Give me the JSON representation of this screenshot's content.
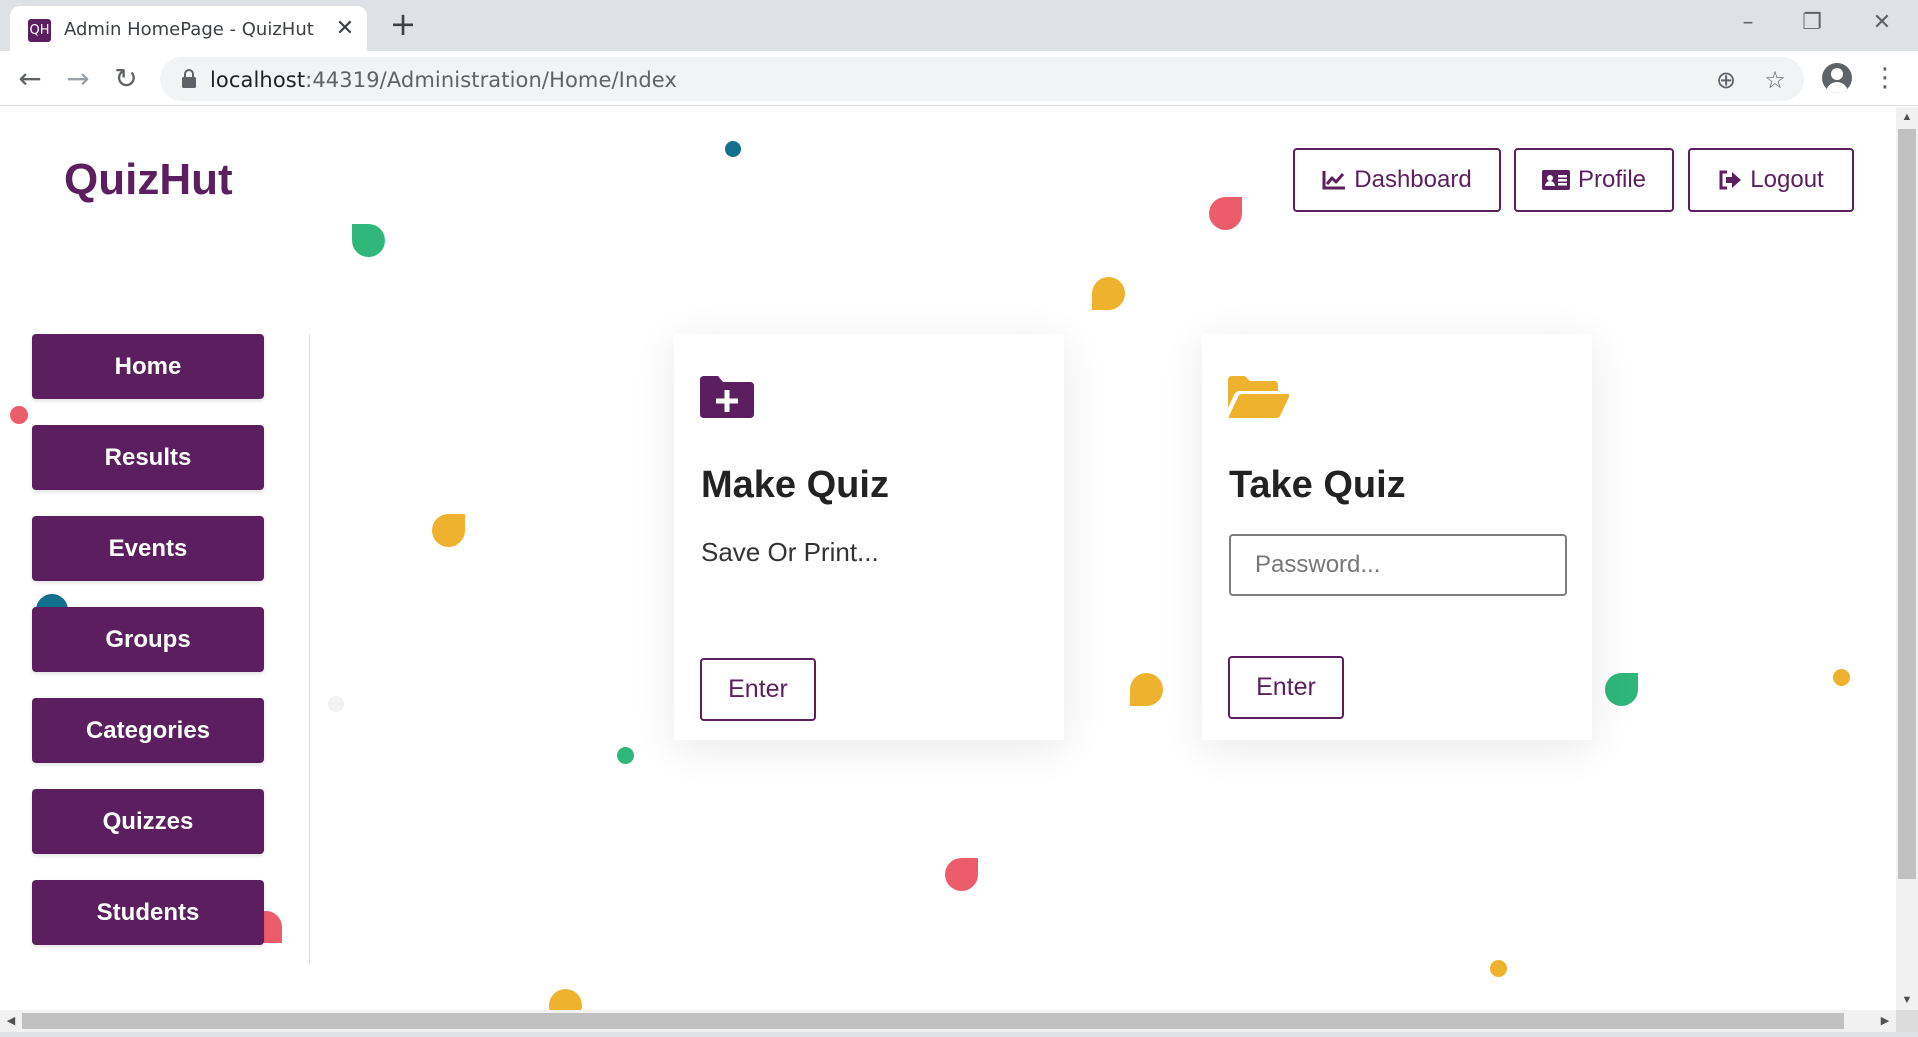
{
  "browser": {
    "tab_title": "Admin HomePage - QuizHut",
    "favicon_text": "QH",
    "url_host": "localhost",
    "url_rest": ":44319/Administration/Home/Index"
  },
  "header": {
    "brand": "QuizHut",
    "buttons": {
      "dashboard": "Dashboard",
      "profile": "Profile",
      "logout": "Logout"
    }
  },
  "sidebar": {
    "items": [
      {
        "label": "Home"
      },
      {
        "label": "Results"
      },
      {
        "label": "Events"
      },
      {
        "label": "Groups"
      },
      {
        "label": "Categories"
      },
      {
        "label": "Quizzes"
      },
      {
        "label": "Students"
      }
    ]
  },
  "cards": {
    "make_quiz": {
      "title": "Make Quiz",
      "subtitle": "Save Or Print...",
      "button": "Enter",
      "icon": "folder-plus-icon"
    },
    "take_quiz": {
      "title": "Take Quiz",
      "placeholder": "Password...",
      "button": "Enter",
      "icon": "folder-open-icon"
    }
  },
  "colors": {
    "brand": "#5b1f60",
    "accent_yellow": "#efb22e",
    "blob_red": "#eb5d6a",
    "blob_green": "#2fb67a",
    "blob_teal": "#136f8e"
  }
}
